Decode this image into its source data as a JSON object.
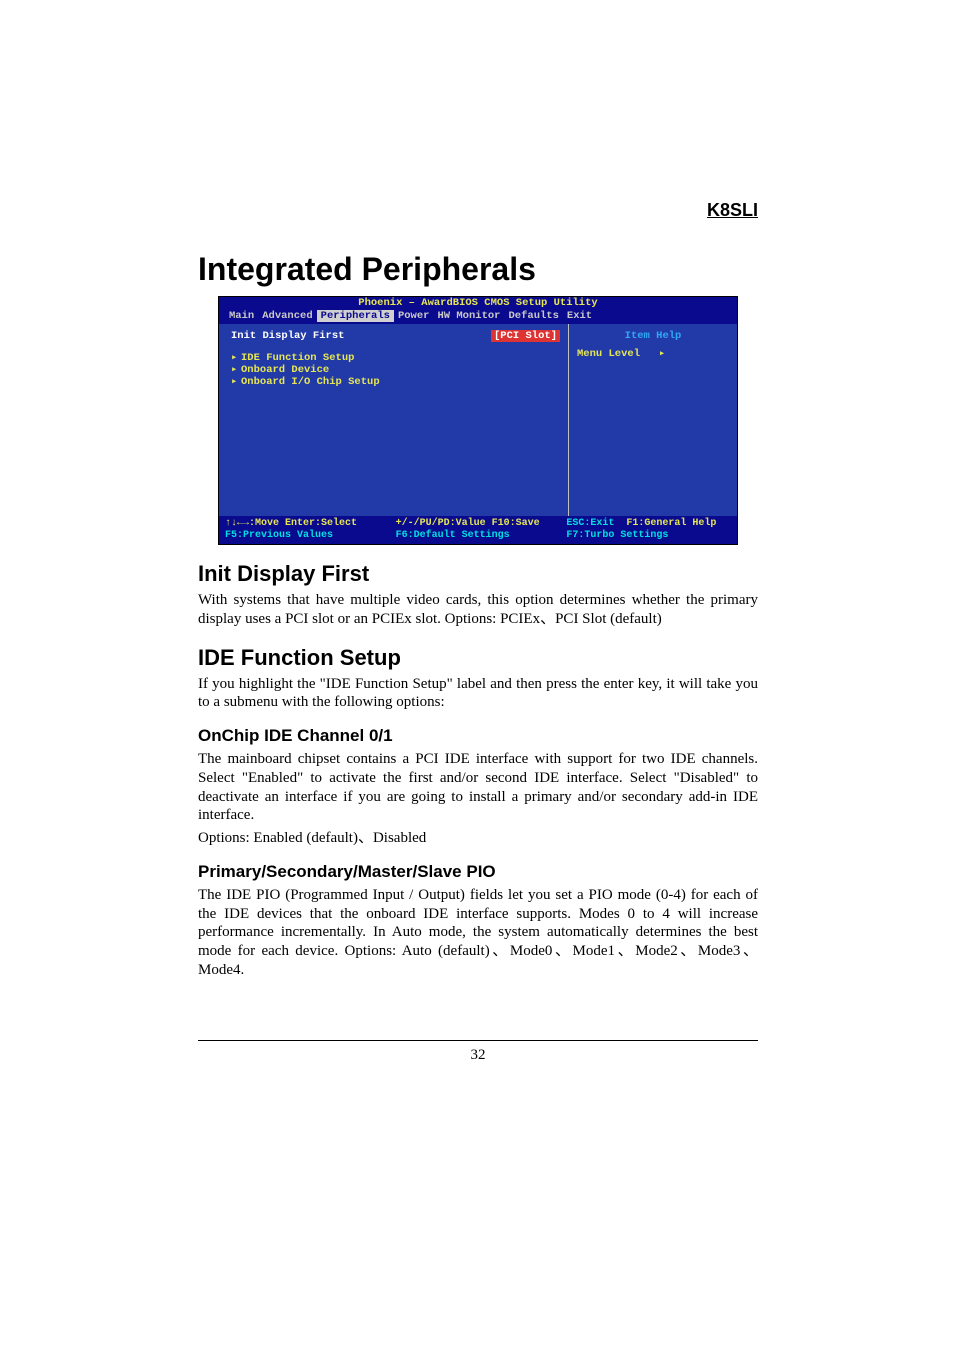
{
  "header": {
    "product": "K8SLI"
  },
  "title": "Integrated Peripherals",
  "bios": {
    "title": "Phoenix – AwardBIOS CMOS Setup Utility",
    "menubar": {
      "items": [
        "Main",
        "Advanced",
        "Peripherals",
        "Power",
        "HW Monitor",
        "Defaults",
        "Exit"
      ],
      "active_index": 2
    },
    "main": {
      "option_label": "Init Display First",
      "option_value": "[PCI Slot]",
      "submenus": [
        "IDE Function Setup",
        "Onboard Device",
        "Onboard I/O Chip Setup"
      ]
    },
    "help": {
      "title": "Item Help",
      "menu_level_label": "Menu Level",
      "menu_level_arrow": "▸"
    },
    "footer": {
      "r1c1": "↑↓←→:Move  Enter:Select",
      "r1c2": "+/-/PU/PD:Value  F10:Save",
      "r1c3a": "ESC:Exit",
      "r1c3b": "F1:General Help",
      "r2c1": "F5:Previous Values",
      "r2c2": "F6:Default Settings",
      "r2c3": "F7:Turbo Settings"
    }
  },
  "sections": {
    "init_display_first": {
      "heading": "Init Display First",
      "body": "With systems that have multiple video cards, this option determines whether the primary display uses a PCI slot or an PCIEx slot. Options: PCIEx、PCI Slot (default)"
    },
    "ide_function_setup": {
      "heading": "IDE Function Setup",
      "body": "If you highlight the \"IDE Function Setup\" label and then press the enter key, it will take you to a submenu with the following options:"
    },
    "onchip_ide": {
      "heading": "OnChip IDE Channel 0/1",
      "body1": "The mainboard chipset contains a PCI IDE interface with support for two IDE channels. Select \"Enabled\" to activate the first and/or second IDE interface. Select \"Disabled\" to deactivate an interface if you are going to install a primary and/or secondary add-in IDE interface.",
      "body2": "Options: Enabled (default)、Disabled"
    },
    "pio": {
      "heading": "Primary/Secondary/Master/Slave PIO",
      "body": "The IDE PIO (Programmed Input / Output) fields let you set a PIO mode (0-4) for each of the IDE devices that the onboard IDE interface supports. Modes 0 to 4 will increase performance incrementally. In Auto mode, the system automatically determines the best mode for each device. Options: Auto (default)、Mode0、Mode1、Mode2、Mode3、Mode4."
    }
  },
  "page_number": "32"
}
